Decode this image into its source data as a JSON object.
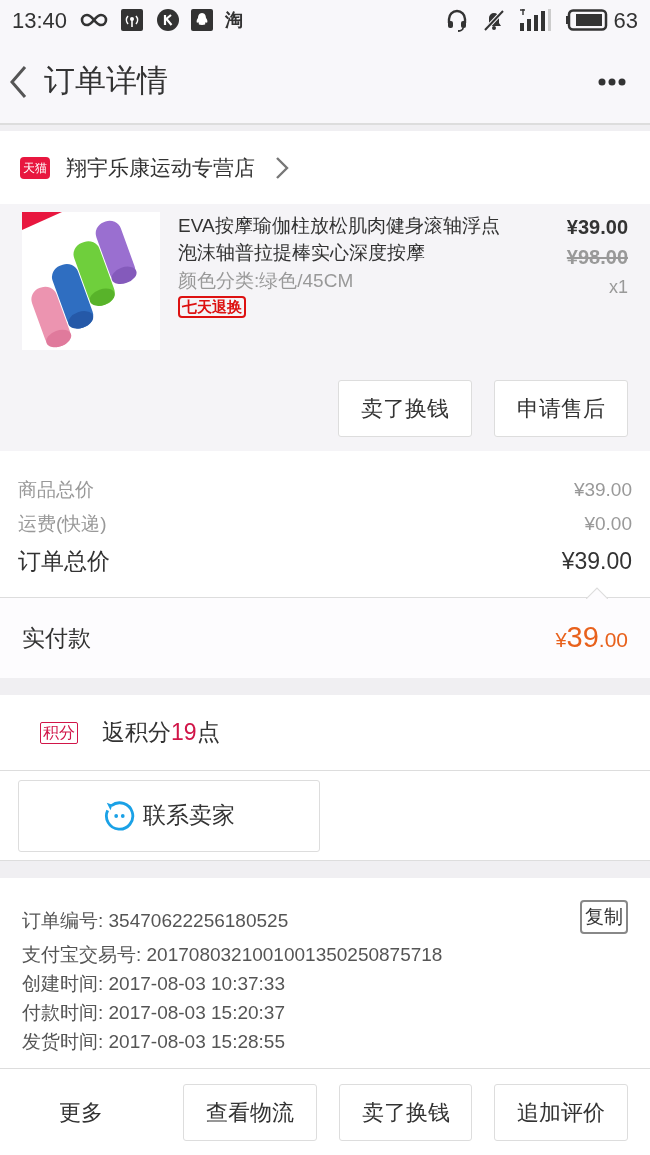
{
  "status_bar": {
    "time": "13:40",
    "notification_icon_text": "淘",
    "battery": "63"
  },
  "nav": {
    "title": "订单详情"
  },
  "store": {
    "badge": "天猫",
    "name": "翔宇乐康运动专营店"
  },
  "product": {
    "title": "EVA按摩瑜伽柱放松肌肉健身滚轴浮点泡沫轴普拉提棒实心深度按摩",
    "variant": "颜色分类:绿色/45CM",
    "tag": "七天退换",
    "price": "¥39.00",
    "original_price": "¥98.00",
    "quantity": "x1",
    "actions": [
      "卖了换钱",
      "申请售后"
    ]
  },
  "summary": [
    {
      "label": "商品总价",
      "value": "¥39.00",
      "kind": "minor"
    },
    {
      "label": "运费(快递)",
      "value": "¥0.00",
      "kind": "minor"
    },
    {
      "label": "订单总价",
      "value": "¥39.00",
      "kind": "major"
    }
  ],
  "paid": {
    "label": "实付款",
    "currency": "¥",
    "integer": "39",
    "decimal": ".00"
  },
  "points": {
    "badge": "积分",
    "before": "返积分",
    "number": "19",
    "after": "点"
  },
  "contact_button": "联系卖家",
  "order_info": {
    "copy_button": "复制",
    "rows": [
      {
        "label": "订单编号:",
        "value": "35470622256180525"
      },
      {
        "label": "支付宝交易号:",
        "value": "2017080321001001350250875718"
      },
      {
        "label": "创建时间:",
        "value": "2017-08-03 10:37:33"
      },
      {
        "label": "付款时间:",
        "value": "2017-08-03 15:20:37"
      },
      {
        "label": "发货时间:",
        "value": "2017-08-03 15:28:55"
      }
    ]
  },
  "bottom_bar": {
    "more": "更多",
    "buttons": [
      "查看物流",
      "卖了换钱",
      "追加评价"
    ]
  }
}
